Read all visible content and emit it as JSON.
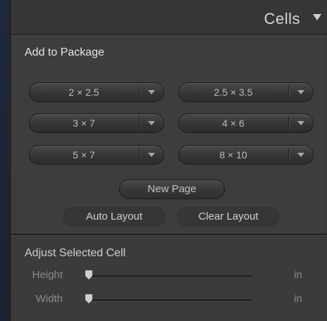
{
  "panel": {
    "title": "Cells"
  },
  "add_to_package": {
    "title": "Add to Package",
    "sizes": [
      {
        "label": "2 × 2.5"
      },
      {
        "label": "2.5 × 3.5"
      },
      {
        "label": "3 × 7"
      },
      {
        "label": "4 × 6"
      },
      {
        "label": "5 × 7"
      },
      {
        "label": "8 × 10"
      }
    ],
    "new_page_label": "New Page",
    "auto_layout_label": "Auto Layout",
    "clear_layout_label": "Clear Layout"
  },
  "adjust_cell": {
    "title": "Adjust Selected Cell",
    "sliders": [
      {
        "label": "Height",
        "unit": "in",
        "value": 0.0
      },
      {
        "label": "Width",
        "unit": "in",
        "value": 0.0
      }
    ]
  },
  "colors": {
    "panel_bg": "#3a3a3a",
    "text": "#e6e6e6",
    "muted": "#8a8a8a"
  }
}
